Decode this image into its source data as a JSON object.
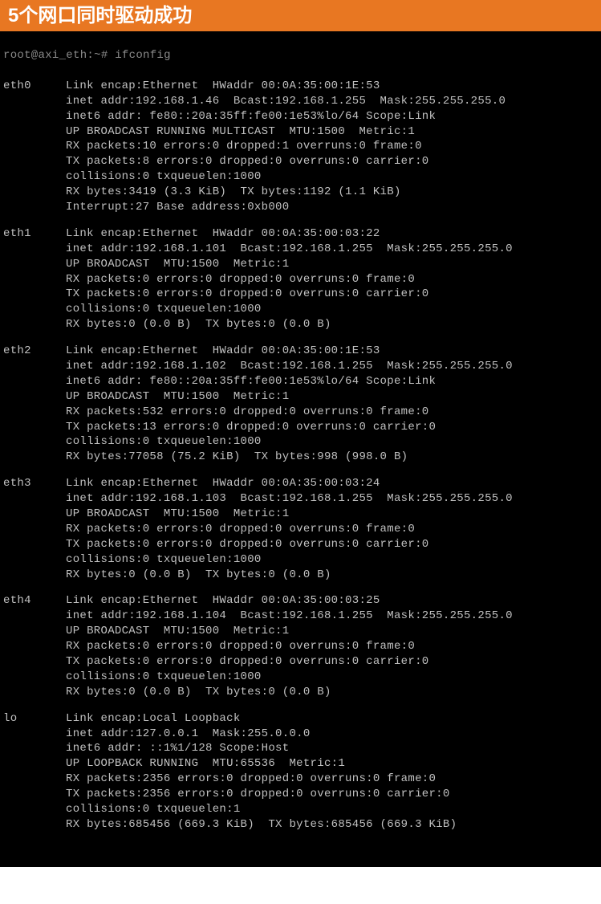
{
  "header": {
    "text": "5个网口同时驱动成功"
  },
  "prompt": "root@axi_eth:~# ifconfig",
  "interfaces": [
    {
      "name": "eth0",
      "lines": [
        "Link encap:Ethernet  HWaddr 00:0A:35:00:1E:53",
        "inet addr:192.168.1.46  Bcast:192.168.1.255  Mask:255.255.255.0",
        "inet6 addr: fe80::20a:35ff:fe00:1e53%lo/64 Scope:Link",
        "UP BROADCAST RUNNING MULTICAST  MTU:1500  Metric:1",
        "RX packets:10 errors:0 dropped:1 overruns:0 frame:0",
        "TX packets:8 errors:0 dropped:0 overruns:0 carrier:0",
        "collisions:0 txqueuelen:1000",
        "RX bytes:3419 (3.3 KiB)  TX bytes:1192 (1.1 KiB)",
        "Interrupt:27 Base address:0xb000"
      ]
    },
    {
      "name": "eth1",
      "lines": [
        "Link encap:Ethernet  HWaddr 00:0A:35:00:03:22",
        "inet addr:192.168.1.101  Bcast:192.168.1.255  Mask:255.255.255.0",
        "UP BROADCAST  MTU:1500  Metric:1",
        "RX packets:0 errors:0 dropped:0 overruns:0 frame:0",
        "TX packets:0 errors:0 dropped:0 overruns:0 carrier:0",
        "collisions:0 txqueuelen:1000",
        "RX bytes:0 (0.0 B)  TX bytes:0 (0.0 B)"
      ]
    },
    {
      "name": "eth2",
      "lines": [
        "Link encap:Ethernet  HWaddr 00:0A:35:00:1E:53",
        "inet addr:192.168.1.102  Bcast:192.168.1.255  Mask:255.255.255.0",
        "inet6 addr: fe80::20a:35ff:fe00:1e53%lo/64 Scope:Link",
        "UP BROADCAST  MTU:1500  Metric:1",
        "RX packets:532 errors:0 dropped:0 overruns:0 frame:0",
        "TX packets:13 errors:0 dropped:0 overruns:0 carrier:0",
        "collisions:0 txqueuelen:1000",
        "RX bytes:77058 (75.2 KiB)  TX bytes:998 (998.0 B)"
      ]
    },
    {
      "name": "eth3",
      "lines": [
        "Link encap:Ethernet  HWaddr 00:0A:35:00:03:24",
        "inet addr:192.168.1.103  Bcast:192.168.1.255  Mask:255.255.255.0",
        "UP BROADCAST  MTU:1500  Metric:1",
        "RX packets:0 errors:0 dropped:0 overruns:0 frame:0",
        "TX packets:0 errors:0 dropped:0 overruns:0 carrier:0",
        "collisions:0 txqueuelen:1000",
        "RX bytes:0 (0.0 B)  TX bytes:0 (0.0 B)"
      ]
    },
    {
      "name": "eth4",
      "lines": [
        "Link encap:Ethernet  HWaddr 00:0A:35:00:03:25",
        "inet addr:192.168.1.104  Bcast:192.168.1.255  Mask:255.255.255.0",
        "UP BROADCAST  MTU:1500  Metric:1",
        "RX packets:0 errors:0 dropped:0 overruns:0 frame:0",
        "TX packets:0 errors:0 dropped:0 overruns:0 carrier:0",
        "collisions:0 txqueuelen:1000",
        "RX bytes:0 (0.0 B)  TX bytes:0 (0.0 B)"
      ]
    },
    {
      "name": "lo",
      "lines": [
        "Link encap:Local Loopback",
        "inet addr:127.0.0.1  Mask:255.0.0.0",
        "inet6 addr: ::1%1/128 Scope:Host",
        "UP LOOPBACK RUNNING  MTU:65536  Metric:1",
        "RX packets:2356 errors:0 dropped:0 overruns:0 frame:0",
        "TX packets:2356 errors:0 dropped:0 overruns:0 carrier:0",
        "collisions:0 txqueuelen:1",
        "RX bytes:685456 (669.3 KiB)  TX bytes:685456 (669.3 KiB)"
      ]
    }
  ]
}
